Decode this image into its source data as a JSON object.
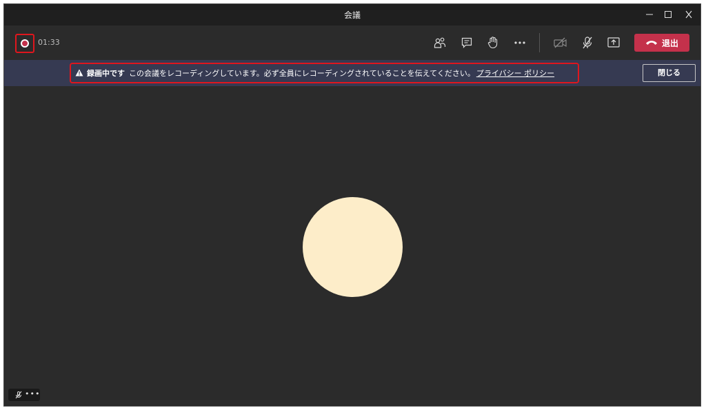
{
  "window": {
    "title": "会議",
    "controls": [
      "minimize-icon",
      "maximize-icon",
      "close-icon"
    ]
  },
  "toolbar": {
    "timer": "01:33",
    "icons": [
      "participants-icon",
      "chat-icon",
      "raise-hand-icon",
      "more-options-icon",
      "camera-off-icon",
      "mic-off-icon",
      "share-screen-icon"
    ],
    "leave_label": "退出"
  },
  "banner": {
    "label": "録画中です",
    "message": "この会議をレコーディングしています。必ず全員にレコーディングされていることを伝えてください。",
    "link": "プライバシー ポリシー",
    "close_label": "閉じる"
  },
  "self_tile": {
    "dots": "•••"
  },
  "colors": {
    "background": "#2b2b2b",
    "titlebar": "#1f1f1f",
    "banner": "#363a52",
    "leave": "#c4314b",
    "avatar": "#fdedc9",
    "highlight": "#e0161d"
  }
}
